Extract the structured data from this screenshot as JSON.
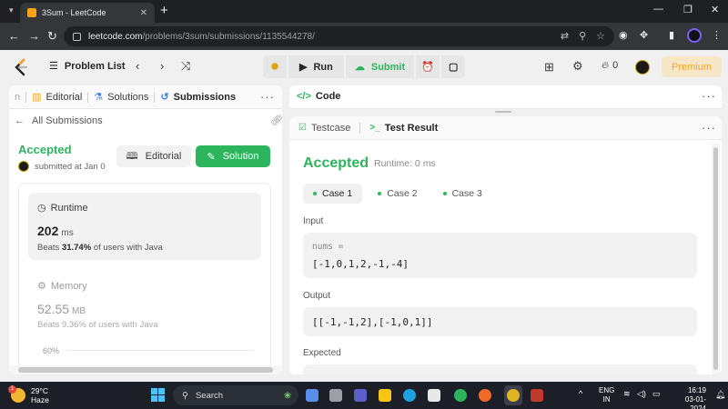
{
  "browser": {
    "tab_title": "3Sum - LeetCode",
    "new_tab_symbol": "+",
    "url_host": "leetcode.com",
    "url_path": "/problems/3sum/submissions/1135544278/"
  },
  "header": {
    "problem_list_label": "Problem List",
    "run_label": "Run",
    "submit_label": "Submit",
    "fire_count": "0",
    "premium_label": "Premium"
  },
  "left_panel": {
    "tabs": {
      "partial": "n",
      "editorial": "Editorial",
      "solutions": "Solutions",
      "submissions": "Submissions"
    },
    "back_label": "All Submissions",
    "status": "Accepted",
    "submitted_text": "submitted at Jan 0",
    "editorial_button": "Editorial",
    "solution_button": "Solution",
    "runtime": {
      "label": "Runtime",
      "value": "202",
      "unit": "ms",
      "beats_prefix": "Beats",
      "beats_value": "31.74%",
      "beats_suffix": "of users with Java"
    },
    "memory": {
      "label": "Memory",
      "value": "52.55",
      "unit": "MB",
      "beats_text": "Beats 9.36% of users with Java"
    },
    "chart_axis_label": "60%"
  },
  "code_panel": {
    "title": "Code"
  },
  "result_panel": {
    "tabs": {
      "testcase": "Testcase",
      "test_result": "Test Result"
    },
    "status": "Accepted",
    "runtime_text": "Runtime: 0 ms",
    "cases": [
      "Case 1",
      "Case 2",
      "Case 3"
    ],
    "input_label": "Input",
    "input_var": "nums =",
    "input_value": "[-1,0,1,2,-1,-4]",
    "output_label": "Output",
    "output_value": "[[-1,-1,2],[-1,0,1]]",
    "expected_label": "Expected"
  },
  "taskbar": {
    "temperature": "29°C",
    "condition": "Haze",
    "weather_badge": "1",
    "search_label": "Search",
    "lang_line1": "ENG",
    "lang_line2": "IN",
    "time": "16:19",
    "date": "03-01-2024"
  },
  "colors": {
    "accent_green": "#2db55d",
    "premium_orange": "#ffa116",
    "browser_dark": "#35363a"
  }
}
